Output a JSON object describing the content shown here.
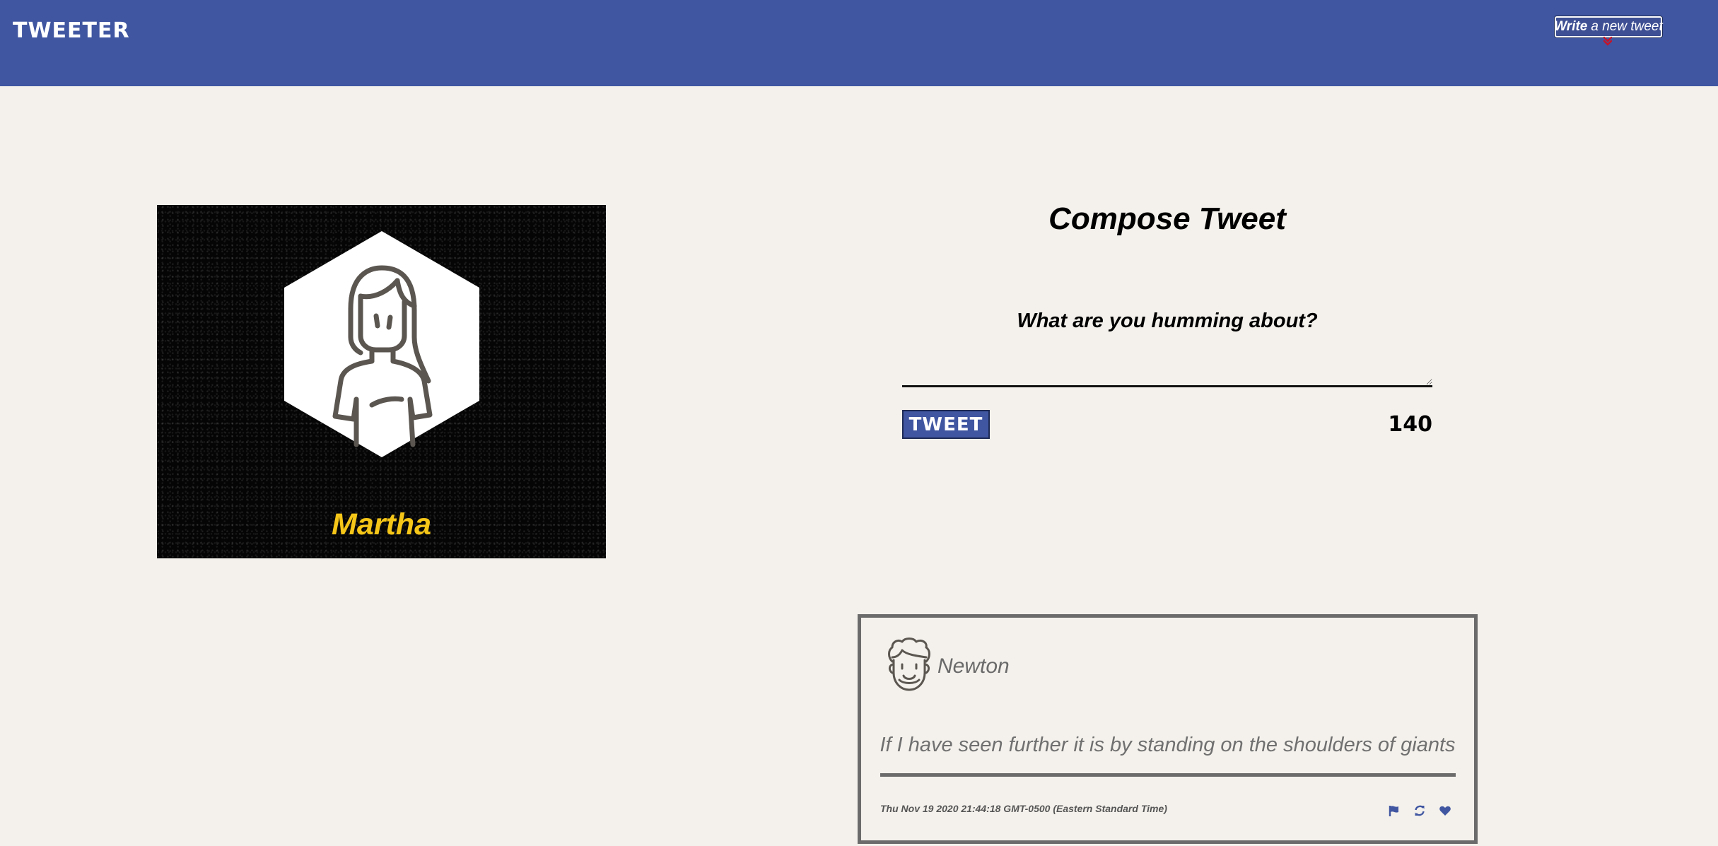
{
  "nav": {
    "brand": "TWEETER",
    "write_bold": "Write",
    "write_rest": "a new tweet"
  },
  "profile": {
    "name": "Martha"
  },
  "compose": {
    "title": "Compose Tweet",
    "prompt": "What are you humming about?",
    "input_value": "",
    "button_label": "TWEET",
    "counter": "140"
  },
  "tweet": {
    "author": "Newton",
    "text": "If I have seen further it is by standing on the shoulders of giants",
    "date": "Thu Nov 19 2020 21:44:18 GMT-0500 (Eastern Standard Time)",
    "actions": [
      "flag-icon",
      "retweet-icon",
      "heart-icon"
    ]
  },
  "colors": {
    "nav_bg": "#4056a1",
    "page_bg": "#f4f1ec",
    "name_yellow": "#f5c618",
    "card_border": "#6b6b6b"
  }
}
